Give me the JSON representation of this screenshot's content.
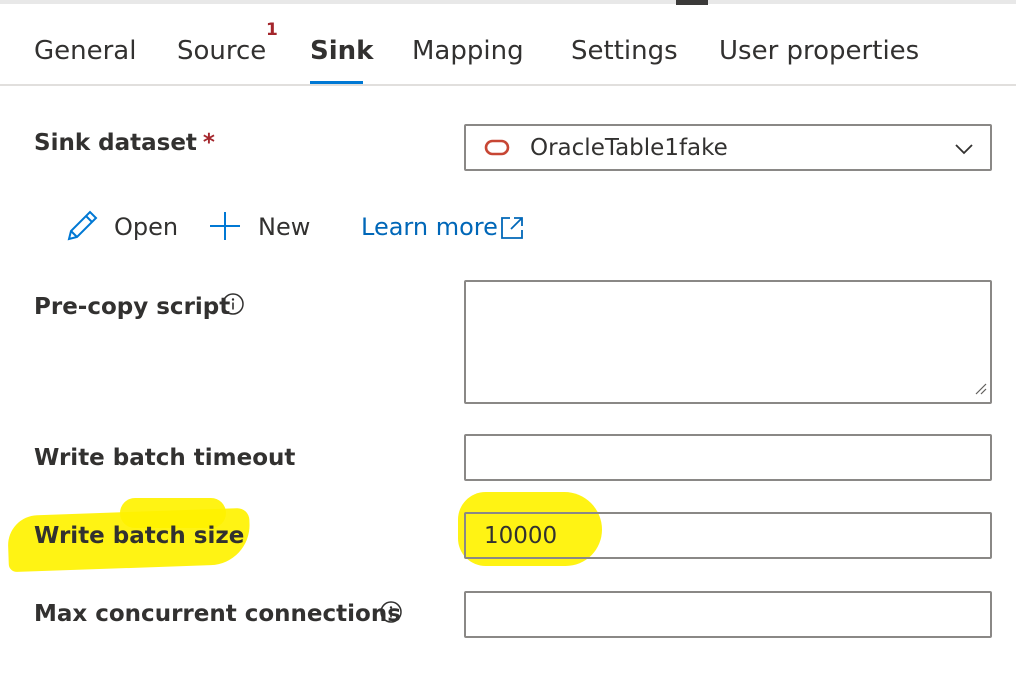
{
  "tabs": [
    {
      "label": "General",
      "active": false
    },
    {
      "label": "Source",
      "active": false,
      "badge": "1"
    },
    {
      "label": "Sink",
      "active": true
    },
    {
      "label": "Mapping",
      "active": false
    },
    {
      "label": "Settings",
      "active": false
    },
    {
      "label": "User properties",
      "active": false
    }
  ],
  "sink_dataset": {
    "label": "Sink dataset",
    "required_mark": "*",
    "value": "OracleTable1fake",
    "icon": "oracle-icon",
    "chevron": "chevron-down-icon"
  },
  "actions": {
    "open_label": "Open",
    "new_label": "New",
    "learn_more_label": "Learn more"
  },
  "pre_copy_script": {
    "label": "Pre-copy script",
    "value": ""
  },
  "write_batch_timeout": {
    "label": "Write batch timeout",
    "value": ""
  },
  "write_batch_size": {
    "label": "Write batch size",
    "value": "10000"
  },
  "max_concurrent_connections": {
    "label": "Max concurrent connections",
    "value": ""
  },
  "colors": {
    "accent": "#0078d4",
    "link": "#0067b8",
    "required": "#a4262c",
    "oracle": "#c74634",
    "highlight": "#fff200"
  }
}
